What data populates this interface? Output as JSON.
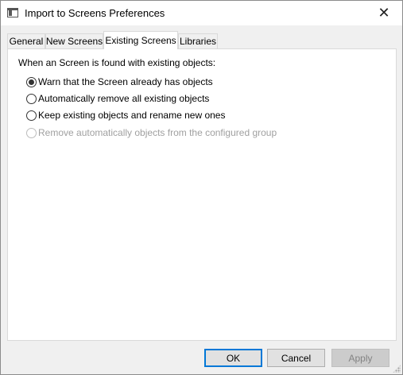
{
  "window": {
    "title": "Import to Screens Preferences",
    "app_icon": "window-app-icon",
    "close_icon": "close-icon",
    "close_glyph": "✕"
  },
  "tabs": [
    {
      "label": "General",
      "active": false
    },
    {
      "label": "New Screens",
      "active": false
    },
    {
      "label": "Existing Screens",
      "active": true
    },
    {
      "label": "Libraries",
      "active": false
    }
  ],
  "panel": {
    "group_label": "When an Screen is found with existing objects:",
    "options": [
      {
        "label": "Warn that the Screen already has objects",
        "checked": true,
        "disabled": false
      },
      {
        "label": "Automatically remove all existing objects",
        "checked": false,
        "disabled": false
      },
      {
        "label": "Keep existing objects and rename new ones",
        "checked": false,
        "disabled": false
      },
      {
        "label": "Remove automatically objects from the configured group",
        "checked": false,
        "disabled": true
      }
    ]
  },
  "buttons": {
    "ok": "OK",
    "cancel": "Cancel",
    "apply": "Apply"
  },
  "colors": {
    "accent": "#0078d7",
    "disabled_text": "#a0a0a0"
  }
}
